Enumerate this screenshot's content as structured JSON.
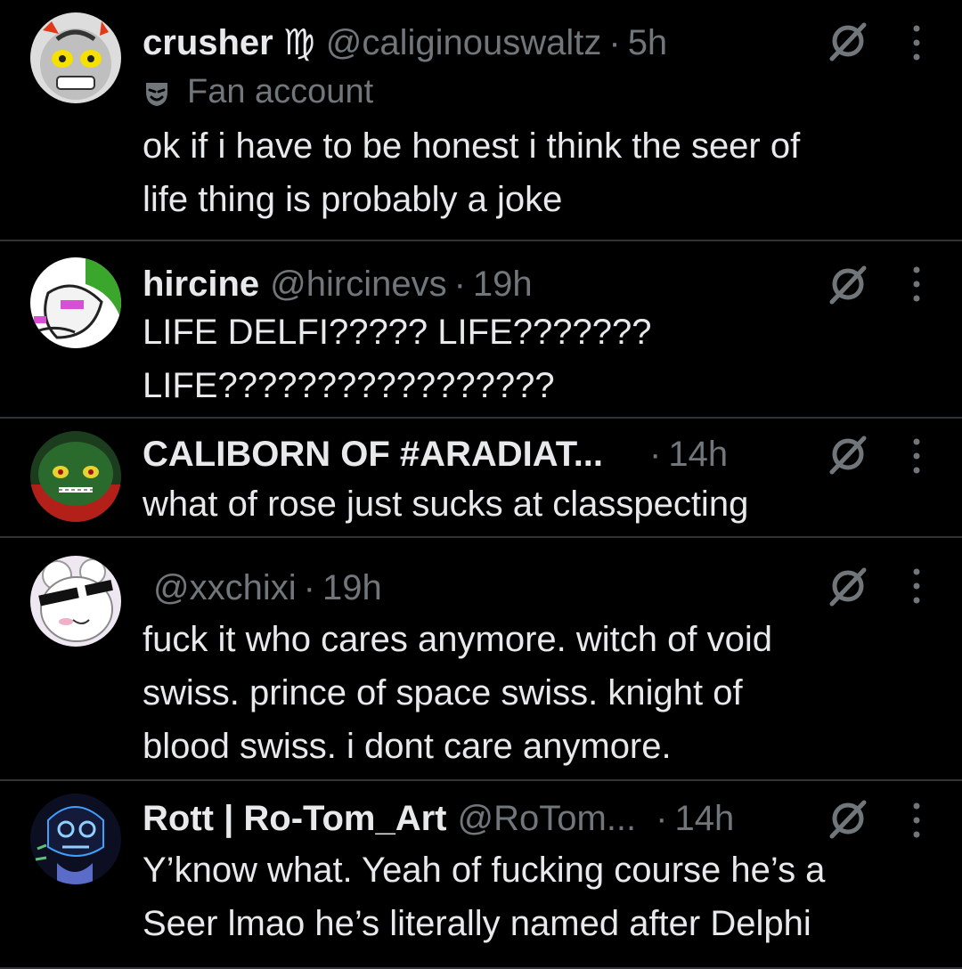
{
  "tweets": [
    {
      "name": "crusher ♍",
      "handle": "@caliginouswaltz",
      "separator": "·",
      "time": "5h",
      "badge": "Fan account",
      "badge_icon": "theater-mask-icon",
      "lines": [
        "ok if i have to be honest i think the seer of",
        "life thing is probably a joke"
      ]
    },
    {
      "name": "hircine",
      "handle": "@hircinevs",
      "separator": "·",
      "time": "19h",
      "lines": [
        "LIFE DELFI????? LIFE???????",
        "LIFE?????????????????"
      ]
    },
    {
      "name": "CALIBORN OF #ARADIAT...",
      "handle": "",
      "separator": "·",
      "time": "14h",
      "lines": [
        "what of rose just sucks at classpecting"
      ]
    },
    {
      "name": "",
      "handle": "@xxchixi",
      "separator": "·",
      "time": "19h",
      "lines": [
        "fuck it who cares anymore. witch of void",
        "swiss. prince of space swiss. knight of",
        "blood swiss. i dont care anymore."
      ]
    },
    {
      "name": "Rott | Ro-Tom_Art",
      "handle": "@RoTom...",
      "separator": "·",
      "time": "14h",
      "lines": [
        "Y’know what. Yeah of fucking course he’s a",
        "Seer lmao he’s literally named after Delphi"
      ]
    }
  ],
  "colors": {
    "background": "#000000",
    "text": "#e7e9ea",
    "muted": "#71767b",
    "divider": "#2f3336"
  },
  "icons": {
    "grok": "grok-icon",
    "more": "more-dots-icon"
  }
}
